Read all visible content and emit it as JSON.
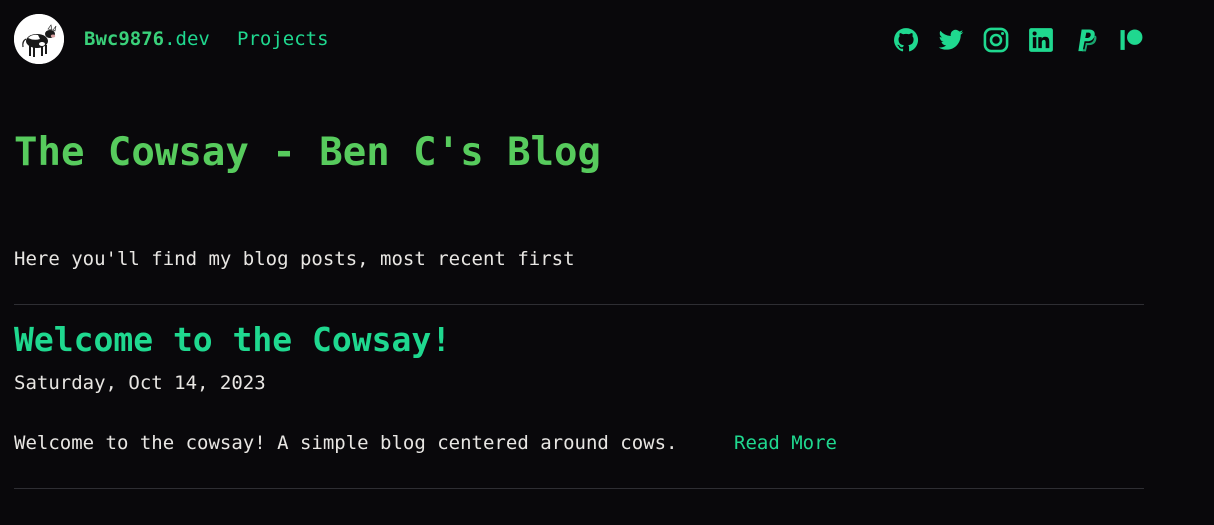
{
  "header": {
    "site_name_bold": "Bwc9876",
    "site_name_tld": ".dev",
    "nav": {
      "projects_label": "Projects"
    },
    "social_icons": [
      "github-icon",
      "twitter-icon",
      "instagram-icon",
      "linkedin-icon",
      "paypal-icon",
      "patreon-icon"
    ]
  },
  "main": {
    "title": "The Cowsay - Ben C's Blog",
    "intro": "Here you'll find my blog posts, most recent first",
    "posts": [
      {
        "title": "Welcome to the Cowsay!",
        "date": "Saturday, Oct 14, 2023",
        "excerpt": "Welcome to the cowsay! A simple blog centered around cows.",
        "read_more_label": "Read More"
      }
    ]
  },
  "colors": {
    "background": "#09080b",
    "accent": "#1fd88f",
    "title_green": "#57cb5d",
    "text": "#e8e6e3",
    "divider": "#2e2e33"
  }
}
